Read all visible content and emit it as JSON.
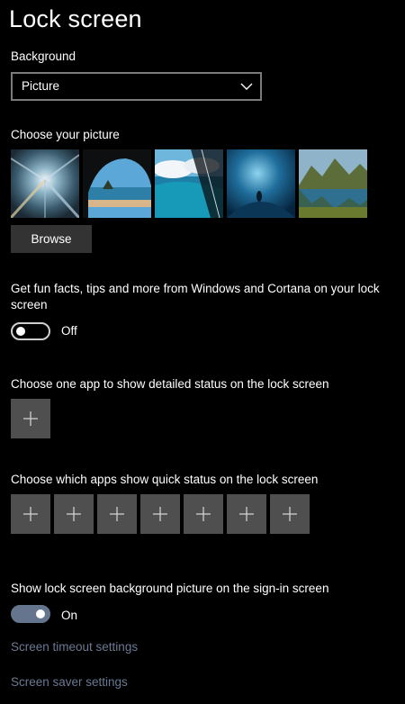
{
  "page": {
    "title": "Lock screen"
  },
  "background": {
    "label": "Background",
    "selected": "Picture"
  },
  "picture": {
    "label": "Choose your picture",
    "browse_label": "Browse"
  },
  "fun_facts": {
    "label": "Get fun facts, tips and more from Windows and Cortana on your lock screen",
    "state_label": "Off",
    "on": false
  },
  "detailed_status": {
    "label": "Choose one app to show detailed status on the lock screen"
  },
  "quick_status": {
    "label": "Choose which apps show quick status on the lock screen"
  },
  "signin_background": {
    "label": "Show lock screen background picture on the sign-in screen",
    "state_label": "On",
    "on": true
  },
  "links": {
    "timeout": "Screen timeout settings",
    "saver": "Screen saver settings"
  },
  "colors": {
    "accent_toggle": "#66758e",
    "link": "#6b7a93",
    "tile": "#4f4f4f",
    "button": "#333333"
  },
  "icons": {
    "dropdown": "chevron-down-icon",
    "tile": "plus-icon"
  }
}
